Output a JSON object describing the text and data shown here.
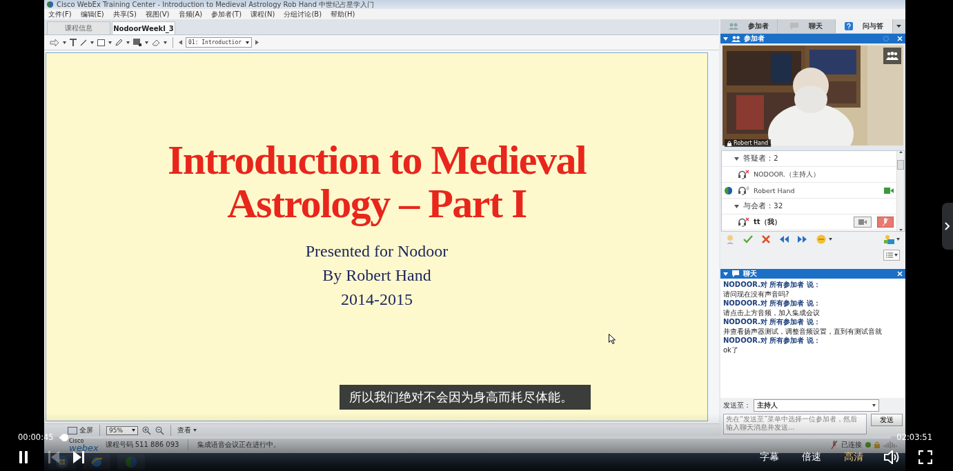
{
  "window": {
    "title": "Cisco WebEx Training Center - Introduction to Medieval Astrology Rob Hand 中世纪占星学入门",
    "menu": [
      "文件(F)",
      "编辑(E)",
      "共享(S)",
      "视图(V)",
      "音频(A)",
      "参加者(T)",
      "课程(N)",
      "分组讨论(B)",
      "帮助(H)"
    ],
    "tabs": [
      {
        "label": "课程信息",
        "selected": false
      },
      {
        "label": "NodoorWeekI_3",
        "selected": true
      }
    ],
    "page_select": "01: Introductior",
    "slide": {
      "title": [
        "Introduction to Medieval",
        "Astrology – Part I"
      ],
      "lines": [
        "Presented for Nodoor",
        "By Robert Hand",
        "2014-2015"
      ]
    },
    "view_bar": {
      "fullscreen": "全屏",
      "zoom": "95%",
      "view": "查看"
    },
    "status_bar": {
      "brand": "Cisco",
      "product": "webex",
      "course_number": "课程号码 511 886 093",
      "audio": "集成语音会议正在进行中。",
      "connection": "已连接"
    }
  },
  "panel": {
    "tabs": [
      {
        "label": "参加者",
        "open": true
      },
      {
        "label": "聊天",
        "open": true
      },
      {
        "label": "问与答",
        "open": false
      }
    ],
    "participants": {
      "title": "参加者",
      "video_name": "Robert Hand",
      "groups": [
        {
          "label": "答疑者：2",
          "expanded": true,
          "children": [
            {
              "name": "NODOOR.（主持人）",
              "muted": true,
              "presenter": false,
              "video": false,
              "self": false
            },
            {
              "name": "Robert Hand",
              "muted": false,
              "presenter": true,
              "video": true,
              "self": false
            }
          ]
        },
        {
          "label": "与会者：32",
          "expanded": true,
          "children": [
            {
              "name": "tt（我）",
              "muted": true,
              "presenter": false,
              "video": false,
              "self": true
            }
          ]
        }
      ]
    },
    "chat": {
      "title": "聊天",
      "messages": [
        {
          "sender": "NODOOR.对 所有参加者 说：",
          "text": "请问现在没有声音吗?"
        },
        {
          "sender": "NODOOR.对 所有参加者 说：",
          "text": "请点击上方音频，加入集成会议"
        },
        {
          "sender": "NODOOR.对 所有参加者 说：",
          "text": "并查看扬声器测试，调整音频设置，直到有测试音就"
        },
        {
          "sender": "NODOOR.对 所有参加者 说：",
          "text": "ok了"
        }
      ],
      "send_to_label": "发送至：",
      "send_to": "主持人",
      "placeholder": "先在“发送至”菜单中选择一位参加者，然后输入聊天消息并发送...",
      "send_button": "发送"
    }
  },
  "player": {
    "subtitle": "所以我们绝对不会因为身高而耗尽体能。",
    "elapsed": "00:00:45",
    "duration": "02:03:51",
    "progress": {
      "level": 0.006
    },
    "previous_disabled": true,
    "options": [
      {
        "label": "字幕",
        "selected": false
      },
      {
        "label": "倍速",
        "selected": false
      },
      {
        "label": "高清",
        "selected": true
      }
    ]
  }
}
